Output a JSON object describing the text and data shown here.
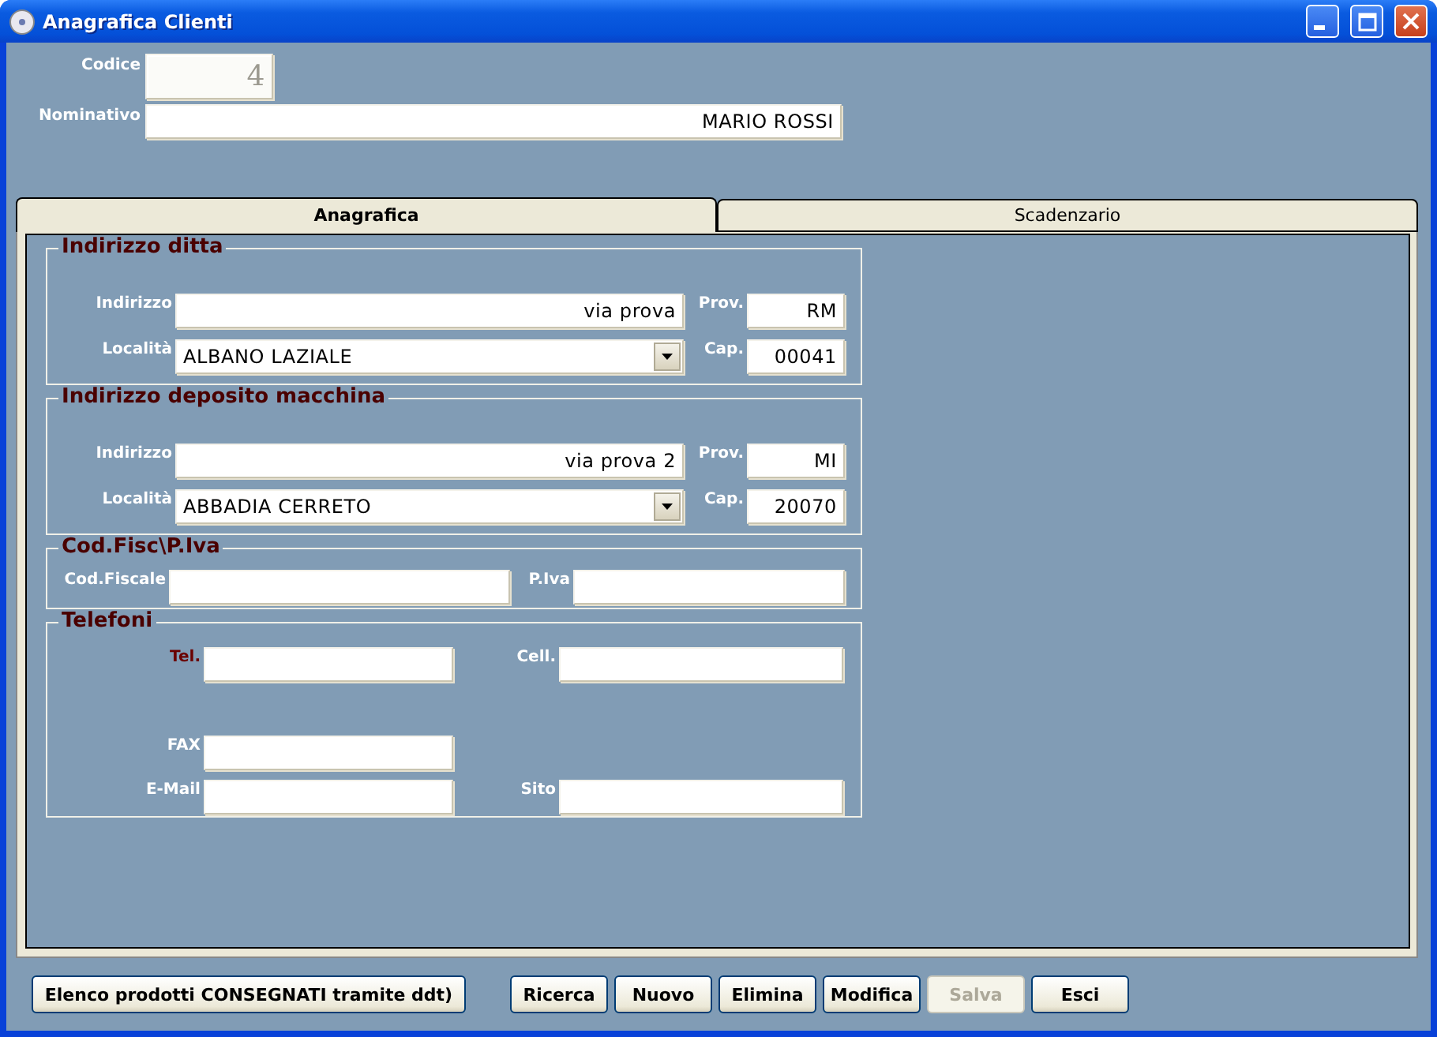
{
  "window": {
    "title": "Anagrafica Clienti"
  },
  "header": {
    "fields": [
      {
        "label": "Codice",
        "value": "4",
        "disabled": true
      },
      {
        "label": "Nominativo",
        "value": "MARIO ROSSI",
        "disabled": false
      }
    ]
  },
  "tabs": [
    {
      "label": "Anagrafica",
      "selected": true
    },
    {
      "label": "Scadenzario",
      "selected": false
    }
  ],
  "groups": [
    {
      "title": "Indirizzo ditta",
      "kind": "address",
      "rows": [
        [
          {
            "label": "Indirizzo",
            "value": "via prova",
            "kind": "text"
          },
          {
            "label": "Prov.",
            "value": "RM",
            "kind": "text"
          }
        ],
        [
          {
            "label": "Località",
            "value": "ALBANO LAZIALE",
            "kind": "dropdown"
          },
          {
            "label": "Cap.",
            "value": "00041",
            "kind": "text"
          }
        ]
      ]
    },
    {
      "title": "Indirizzo deposito macchina",
      "kind": "address",
      "rows": [
        [
          {
            "label": "Indirizzo",
            "value": "via prova 2",
            "kind": "text"
          },
          {
            "label": "Prov.",
            "value": "MI",
            "kind": "text"
          }
        ],
        [
          {
            "label": "Località",
            "value": "ABBADIA CERRETO",
            "kind": "dropdown"
          },
          {
            "label": "Cap.",
            "value": "20070",
            "kind": "text"
          }
        ]
      ]
    },
    {
      "title": "Cod.Fisc\\P.Iva",
      "kind": "tax",
      "rows": [
        [
          {
            "label": "Cod.Fiscale",
            "kind": "text"
          },
          {
            "label": "P.Iva",
            "kind": "text"
          }
        ]
      ]
    },
    {
      "title": "Telefoni",
      "kind": "phones",
      "rows": [
        [
          {
            "label": "Tel.",
            "kind": "text",
            "required": true
          },
          {
            "label": "Cell.",
            "kind": "text",
            "required": false
          }
        ],
        [
          {
            "label": "FAX",
            "kind": "text",
            "required": false
          }
        ],
        [
          {
            "label": "E-Mail",
            "kind": "text",
            "required": false
          },
          {
            "label": "Sito",
            "kind": "text",
            "required": false
          }
        ]
      ]
    }
  ],
  "buttons": [
    {
      "label": "Elenco prodotti CONSEGNATI tramite ddt)",
      "disabled": false
    },
    {
      "label": "Ricerca",
      "disabled": false
    },
    {
      "label": "Nuovo",
      "disabled": false
    },
    {
      "label": "Elimina",
      "disabled": false
    },
    {
      "label": "Modifica",
      "disabled": false
    },
    {
      "label": "Salva",
      "disabled": true
    },
    {
      "label": "Esci",
      "disabled": false
    }
  ]
}
